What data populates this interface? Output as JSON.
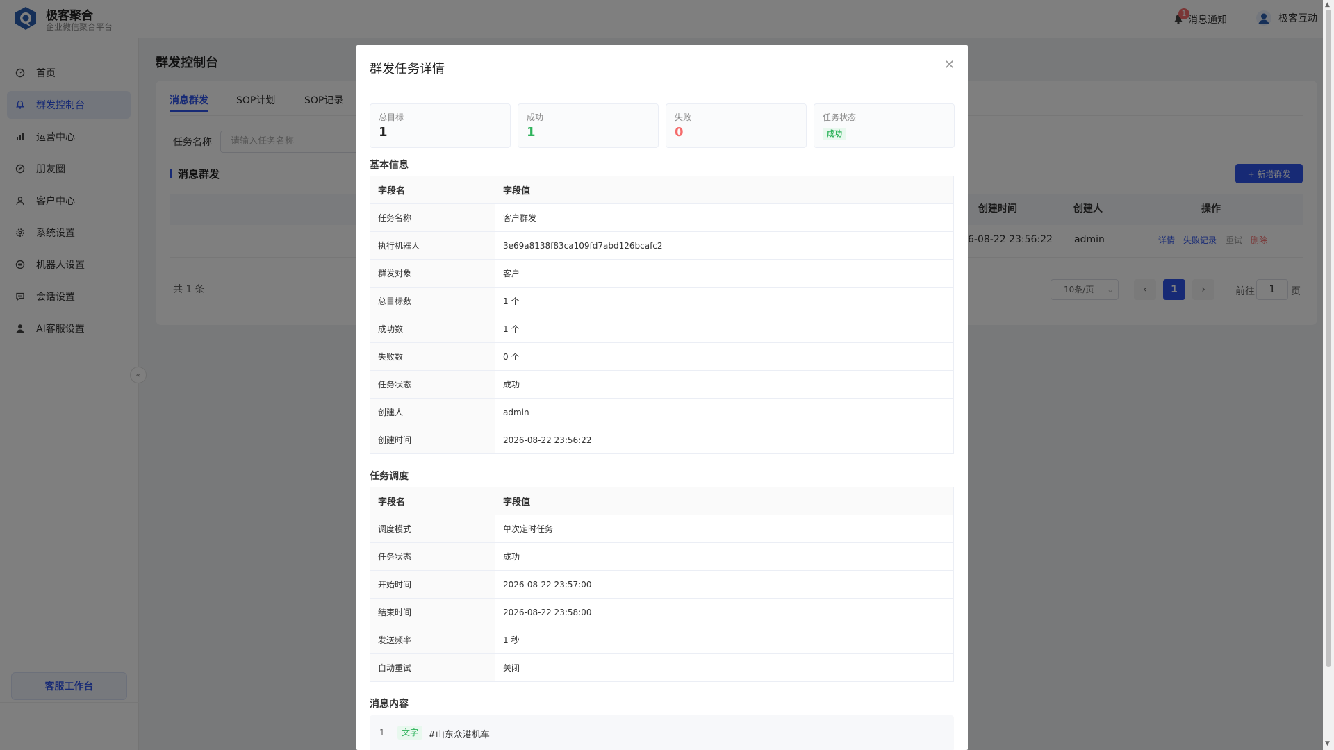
{
  "header": {
    "brand_title": "极客聚合",
    "brand_subtitle": "企业微信聚合平台",
    "notify_label": "消息通知",
    "notify_count": "1",
    "user_name": "极客互动"
  },
  "sidebar": {
    "items": [
      {
        "label": "首页",
        "icon": "dashboard-icon"
      },
      {
        "label": "群发控制台",
        "icon": "bell-icon",
        "active": true
      },
      {
        "label": "运营中心",
        "icon": "chart-icon"
      },
      {
        "label": "朋友圈",
        "icon": "compass-icon"
      },
      {
        "label": "客户中心",
        "icon": "user-icon"
      },
      {
        "label": "系统设置",
        "icon": "gear-icon"
      },
      {
        "label": "机器人设置",
        "icon": "robot-icon"
      },
      {
        "label": "会话设置",
        "icon": "chat-icon"
      },
      {
        "label": "AI客服设置",
        "icon": "person-icon"
      }
    ],
    "workbench_label": "客服工作台"
  },
  "main": {
    "page_title": "群发控制台",
    "tabs": [
      "消息群发",
      "SOP计划",
      "SOP记录"
    ],
    "filter_label": "任务名称",
    "filter_placeholder": "请输入任务名称",
    "section_title": "消息群发",
    "add_button": "+ 新增群发",
    "columns": [
      "创建时间",
      "创建人",
      "操作"
    ],
    "row": {
      "created_at": "6-08-22 23:56:22",
      "creator": "admin",
      "ops": [
        "详情",
        "失败记录",
        "重试",
        "删除"
      ]
    },
    "total": "共 1 条",
    "page_size": "10条/页",
    "current_page": "1",
    "goto_prefix": "前往",
    "goto_value": "1",
    "goto_suffix": "页"
  },
  "modal": {
    "title": "群发任务详情",
    "stats": [
      {
        "label": "总目标",
        "value": "1",
        "color": "#222222"
      },
      {
        "label": "成功",
        "value": "1",
        "color": "#2fb35c"
      },
      {
        "label": "失败",
        "value": "0",
        "color": "#f56c6c"
      },
      {
        "label": "任务状态",
        "value": "成功",
        "tag": true
      }
    ],
    "basic_info_title": "基本信息",
    "head_key": "字段名",
    "head_value": "字段值",
    "basic_rows": [
      [
        "任务名称",
        "客户群发"
      ],
      [
        "执行机器人",
        "3e69a8138f83ca109fd7abd126bcafc2"
      ],
      [
        "群发对象",
        "客户"
      ],
      [
        "总目标数",
        "1 个"
      ],
      [
        "成功数",
        "1 个"
      ],
      [
        "失败数",
        "0 个"
      ],
      [
        "任务状态",
        "成功"
      ],
      [
        "创建人",
        "admin"
      ],
      [
        "创建时间",
        "2026-08-22 23:56:22"
      ]
    ],
    "schedule_title": "任务调度",
    "schedule_rows": [
      [
        "调度模式",
        "单次定时任务"
      ],
      [
        "任务状态",
        "成功"
      ],
      [
        "开始时间",
        "2026-08-22 23:57:00"
      ],
      [
        "结束时间",
        "2026-08-22 23:58:00"
      ],
      [
        "发送频率",
        "1 秒"
      ],
      [
        "自动重试",
        "关闭"
      ]
    ],
    "content_title": "消息内容",
    "messages": [
      {
        "index": "1",
        "type": "文字",
        "text": "#山东众港机车"
      }
    ]
  },
  "colors": {
    "primary": "#2f54eb",
    "success": "#2fb35c",
    "danger": "#f56c6c"
  }
}
